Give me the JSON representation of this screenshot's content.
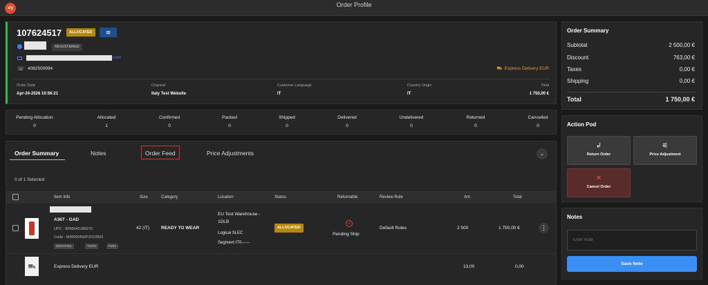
{
  "app": {
    "logo_text": "x/y",
    "title": "Order Profile"
  },
  "order": {
    "id": "107624517",
    "status_badge": "ALLOCATED",
    "customer_status": "REGISTERED",
    "email_suffix": "com",
    "phone": "4082500994",
    "delivery_method": "Express Delivery EUR",
    "meta": [
      {
        "label": "Order Date",
        "value": "Apr-24-2026 10:56:21"
      },
      {
        "label": "Channel",
        "value": "Italy Test Website"
      },
      {
        "label": "Customer Language",
        "value": "IT"
      },
      {
        "label": "Country Origin",
        "value": "IT"
      },
      {
        "label": "Total",
        "value": "1 750,00 €"
      }
    ]
  },
  "status_counts": [
    {
      "label": "Pending Allocation",
      "value": "0"
    },
    {
      "label": "Allocated",
      "value": "1"
    },
    {
      "label": "Confirmed",
      "value": "0"
    },
    {
      "label": "Packed",
      "value": "0"
    },
    {
      "label": "Shipped",
      "value": "0"
    },
    {
      "label": "Delivered",
      "value": "0"
    },
    {
      "label": "Undelivered",
      "value": "0"
    },
    {
      "label": "Returned",
      "value": "0"
    },
    {
      "label": "Cancelled",
      "value": "0"
    }
  ],
  "tabs": [
    "Order Summary",
    "Notes",
    "Order Feed",
    "Price Adjustments"
  ],
  "table": {
    "selected_text": "0 of 1 Selected",
    "headers": [
      "Item Info",
      "Size",
      "Category",
      "Location",
      "Status",
      "Returnable",
      "Review Rule",
      "Am",
      "Total"
    ],
    "item": {
      "name": "A36T - GAD",
      "upc": "UPC : 8056643186276",
      "code": "Code : M00000NI2PZ010501",
      "tags": [
        "3WHVA00L",
        "T04P1",
        "PZ01"
      ],
      "size": "42 (IT)",
      "category": "READY TO WEAR",
      "location_line1": "EU Test Warehouse -",
      "location_line2": "1DLB",
      "logical": "Logical SLEC",
      "segment": "Segment IT0------",
      "status": "ALLOCATED",
      "returnable_status": "Pending Ship",
      "review_rule": "Default Rules",
      "amount": "2 500",
      "total": "1 750,00 €",
      "kebab": "⋮"
    },
    "shipping": {
      "name": "Express Delivery EUR",
      "amount": "13,00",
      "total": "0,00"
    }
  },
  "summary": {
    "title": "Order Summary",
    "rows": [
      {
        "label": "Subtotal",
        "value": "2 500,00 €"
      },
      {
        "label": "Discount",
        "value": "763,00 €"
      },
      {
        "label": "Taxes",
        "value": "0,00 €"
      },
      {
        "label": "Shipping",
        "value": "0,00 €"
      }
    ],
    "total_label": "Total",
    "total_value": "1 750,00 €"
  },
  "action_pod": {
    "title": "Action Pod",
    "return_label": "Return Order",
    "price_label": "Price Adjustment",
    "cancel_label": "Cancel Order",
    "return_icon": "↲",
    "price_icon": "⚟",
    "cancel_icon": "✕"
  },
  "notes": {
    "title": "Notes",
    "placeholder": "Enter Note",
    "save_label": "Save Note"
  },
  "colors": {
    "accent_green": "#2ebd52",
    "allocated": "#b8860b",
    "primary_blue": "#3b8ef3",
    "danger": "#e25a5a",
    "delivery": "#e0a030"
  }
}
